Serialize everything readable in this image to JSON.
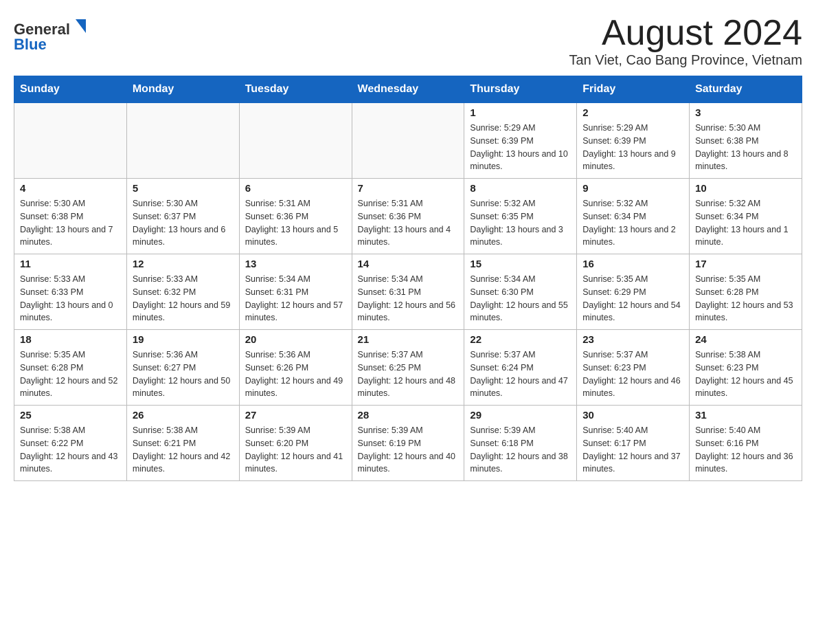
{
  "header": {
    "logo_general": "General",
    "logo_blue": "Blue",
    "month_title": "August 2024",
    "location": "Tan Viet, Cao Bang Province, Vietnam"
  },
  "columns": [
    "Sunday",
    "Monday",
    "Tuesday",
    "Wednesday",
    "Thursday",
    "Friday",
    "Saturday"
  ],
  "weeks": [
    [
      {
        "day": "",
        "info": ""
      },
      {
        "day": "",
        "info": ""
      },
      {
        "day": "",
        "info": ""
      },
      {
        "day": "",
        "info": ""
      },
      {
        "day": "1",
        "info": "Sunrise: 5:29 AM\nSunset: 6:39 PM\nDaylight: 13 hours and 10 minutes."
      },
      {
        "day": "2",
        "info": "Sunrise: 5:29 AM\nSunset: 6:39 PM\nDaylight: 13 hours and 9 minutes."
      },
      {
        "day": "3",
        "info": "Sunrise: 5:30 AM\nSunset: 6:38 PM\nDaylight: 13 hours and 8 minutes."
      }
    ],
    [
      {
        "day": "4",
        "info": "Sunrise: 5:30 AM\nSunset: 6:38 PM\nDaylight: 13 hours and 7 minutes."
      },
      {
        "day": "5",
        "info": "Sunrise: 5:30 AM\nSunset: 6:37 PM\nDaylight: 13 hours and 6 minutes."
      },
      {
        "day": "6",
        "info": "Sunrise: 5:31 AM\nSunset: 6:36 PM\nDaylight: 13 hours and 5 minutes."
      },
      {
        "day": "7",
        "info": "Sunrise: 5:31 AM\nSunset: 6:36 PM\nDaylight: 13 hours and 4 minutes."
      },
      {
        "day": "8",
        "info": "Sunrise: 5:32 AM\nSunset: 6:35 PM\nDaylight: 13 hours and 3 minutes."
      },
      {
        "day": "9",
        "info": "Sunrise: 5:32 AM\nSunset: 6:34 PM\nDaylight: 13 hours and 2 minutes."
      },
      {
        "day": "10",
        "info": "Sunrise: 5:32 AM\nSunset: 6:34 PM\nDaylight: 13 hours and 1 minute."
      }
    ],
    [
      {
        "day": "11",
        "info": "Sunrise: 5:33 AM\nSunset: 6:33 PM\nDaylight: 13 hours and 0 minutes."
      },
      {
        "day": "12",
        "info": "Sunrise: 5:33 AM\nSunset: 6:32 PM\nDaylight: 12 hours and 59 minutes."
      },
      {
        "day": "13",
        "info": "Sunrise: 5:34 AM\nSunset: 6:31 PM\nDaylight: 12 hours and 57 minutes."
      },
      {
        "day": "14",
        "info": "Sunrise: 5:34 AM\nSunset: 6:31 PM\nDaylight: 12 hours and 56 minutes."
      },
      {
        "day": "15",
        "info": "Sunrise: 5:34 AM\nSunset: 6:30 PM\nDaylight: 12 hours and 55 minutes."
      },
      {
        "day": "16",
        "info": "Sunrise: 5:35 AM\nSunset: 6:29 PM\nDaylight: 12 hours and 54 minutes."
      },
      {
        "day": "17",
        "info": "Sunrise: 5:35 AM\nSunset: 6:28 PM\nDaylight: 12 hours and 53 minutes."
      }
    ],
    [
      {
        "day": "18",
        "info": "Sunrise: 5:35 AM\nSunset: 6:28 PM\nDaylight: 12 hours and 52 minutes."
      },
      {
        "day": "19",
        "info": "Sunrise: 5:36 AM\nSunset: 6:27 PM\nDaylight: 12 hours and 50 minutes."
      },
      {
        "day": "20",
        "info": "Sunrise: 5:36 AM\nSunset: 6:26 PM\nDaylight: 12 hours and 49 minutes."
      },
      {
        "day": "21",
        "info": "Sunrise: 5:37 AM\nSunset: 6:25 PM\nDaylight: 12 hours and 48 minutes."
      },
      {
        "day": "22",
        "info": "Sunrise: 5:37 AM\nSunset: 6:24 PM\nDaylight: 12 hours and 47 minutes."
      },
      {
        "day": "23",
        "info": "Sunrise: 5:37 AM\nSunset: 6:23 PM\nDaylight: 12 hours and 46 minutes."
      },
      {
        "day": "24",
        "info": "Sunrise: 5:38 AM\nSunset: 6:23 PM\nDaylight: 12 hours and 45 minutes."
      }
    ],
    [
      {
        "day": "25",
        "info": "Sunrise: 5:38 AM\nSunset: 6:22 PM\nDaylight: 12 hours and 43 minutes."
      },
      {
        "day": "26",
        "info": "Sunrise: 5:38 AM\nSunset: 6:21 PM\nDaylight: 12 hours and 42 minutes."
      },
      {
        "day": "27",
        "info": "Sunrise: 5:39 AM\nSunset: 6:20 PM\nDaylight: 12 hours and 41 minutes."
      },
      {
        "day": "28",
        "info": "Sunrise: 5:39 AM\nSunset: 6:19 PM\nDaylight: 12 hours and 40 minutes."
      },
      {
        "day": "29",
        "info": "Sunrise: 5:39 AM\nSunset: 6:18 PM\nDaylight: 12 hours and 38 minutes."
      },
      {
        "day": "30",
        "info": "Sunrise: 5:40 AM\nSunset: 6:17 PM\nDaylight: 12 hours and 37 minutes."
      },
      {
        "day": "31",
        "info": "Sunrise: 5:40 AM\nSunset: 6:16 PM\nDaylight: 12 hours and 36 minutes."
      }
    ]
  ]
}
